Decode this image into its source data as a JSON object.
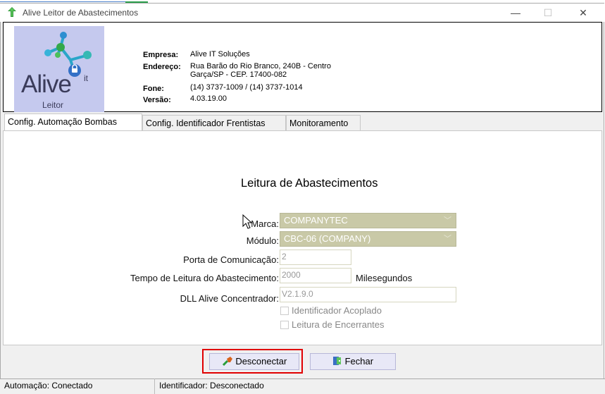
{
  "window": {
    "title": "Alive Leitor de Abastecimentos",
    "minimize_glyph": "—",
    "maximize_glyph": "☐",
    "close_glyph": "✕"
  },
  "logo": {
    "brand": "Alive",
    "superscript": "it",
    "subtitle": "Leitor"
  },
  "company": {
    "empresa_label": "Empresa:",
    "empresa_value": "Alive IT Soluções",
    "endereco_label": "Endereço:",
    "endereco_value_line1": "Rua Barão do Rio Branco, 240B - Centro",
    "endereco_value_line2": "Garça/SP - CEP. 17400-082",
    "fone_label": "Fone:",
    "fone_value": "(14) 3737-1009 / (14) 3737-1014",
    "versao_label": "Versão:",
    "versao_value": "4.03.19.00"
  },
  "tabs": [
    {
      "label": "Config. Automação Bombas",
      "active": true
    },
    {
      "label": "Config. Identificador Frentistas",
      "active": false
    },
    {
      "label": "Monitoramento",
      "active": false
    }
  ],
  "form": {
    "title": "Leitura de Abastecimentos",
    "marca_label": "Marca:",
    "marca_value": "COMPANYTEC",
    "modulo_label": "Módulo:",
    "modulo_value": "CBC-06 (COMPANY)",
    "porta_label": "Porta de Comunicação:",
    "porta_value": "2",
    "tempo_label": "Tempo de Leitura do Abastecimento:",
    "tempo_value": "2000",
    "tempo_unit": "Milesegundos",
    "dll_label": "DLL Alive Concentrador:",
    "dll_value": "V2.1.9.0",
    "identificador_label": "Identificador Acoplado",
    "leitura_label": "Leitura de Encerrantes"
  },
  "buttons": {
    "disconnect_label": "Desconectar",
    "close_label": "Fechar"
  },
  "status": {
    "automacao": "Automação: Conectado",
    "identificador": "Identificador: Desconectado"
  },
  "colors": {
    "highlight": "#e00000",
    "combo_disabled": "#c9c9a7",
    "logo_bg": "#c5c9ee",
    "button_bg": "#e8e8f7"
  }
}
